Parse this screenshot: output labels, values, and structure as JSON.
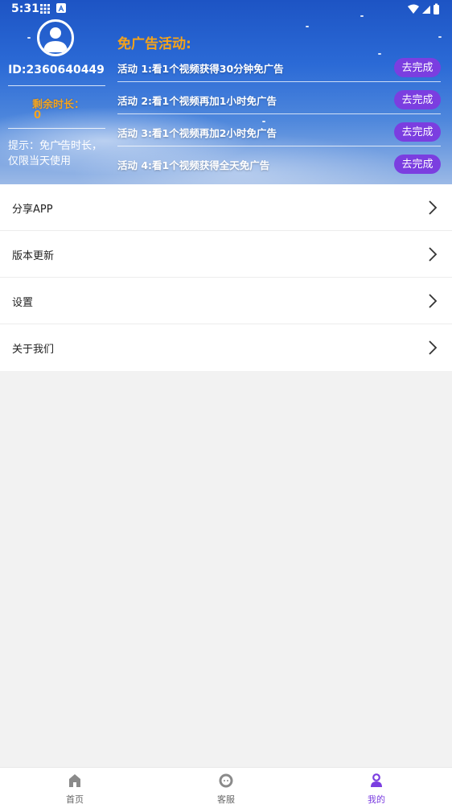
{
  "status_bar": {
    "time": "5:31"
  },
  "profile": {
    "id_text": "ID:2360640449",
    "remaining_label": "剩余时长：",
    "remaining_value": "0",
    "tip": "提示：免广告时长，仅限当天使用"
  },
  "promo": {
    "title": "免广告活动:",
    "activities": [
      {
        "text": "活动 1:看1个视频获得30分钟免广告",
        "button": "去完成"
      },
      {
        "text": "活动 2:看1个视频再加1小时免广告",
        "button": "去完成"
      },
      {
        "text": "活动 3:看1个视频再加2小时免广告",
        "button": "去完成"
      },
      {
        "text": "活动 4:看1个视频获得全天免广告",
        "button": "去完成"
      }
    ]
  },
  "menu": [
    {
      "label": "分享APP"
    },
    {
      "label": "版本更新"
    },
    {
      "label": "设置"
    },
    {
      "label": "关于我们"
    }
  ],
  "bottom_nav": [
    {
      "label": "首页",
      "icon": "home-icon"
    },
    {
      "label": "客服",
      "icon": "customer-service-icon"
    },
    {
      "label": "我的",
      "icon": "profile-icon",
      "active": true
    }
  ],
  "colors": {
    "accent_purple": "#7b3ee0",
    "promo_orange": "#f6a319",
    "header_blue": "#2b6ad6"
  }
}
